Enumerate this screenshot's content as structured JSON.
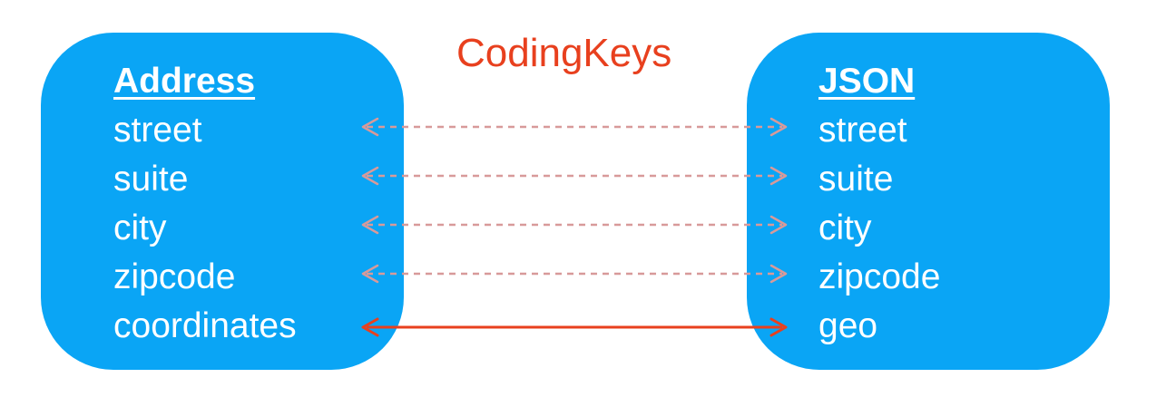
{
  "title": "CodingKeys",
  "left_box": {
    "heading": "Address",
    "fields": [
      "street",
      "suite",
      "city",
      "zipcode",
      "coordinates"
    ]
  },
  "right_box": {
    "heading": "JSON",
    "fields": [
      "street",
      "suite",
      "city",
      "zipcode",
      "geo"
    ]
  },
  "mappings": [
    {
      "from": "street",
      "to": "street",
      "style": "dashed"
    },
    {
      "from": "suite",
      "to": "suite",
      "style": "dashed"
    },
    {
      "from": "city",
      "to": "city",
      "style": "dashed"
    },
    {
      "from": "zipcode",
      "to": "zipcode",
      "style": "dashed"
    },
    {
      "from": "coordinates",
      "to": "geo",
      "style": "solid"
    }
  ],
  "colors": {
    "box_fill": "#0aa5f5",
    "box_text": "#ffffff",
    "title": "#e8401e",
    "dashed_arrow": "#d89a9a",
    "solid_arrow": "#e8401e"
  }
}
